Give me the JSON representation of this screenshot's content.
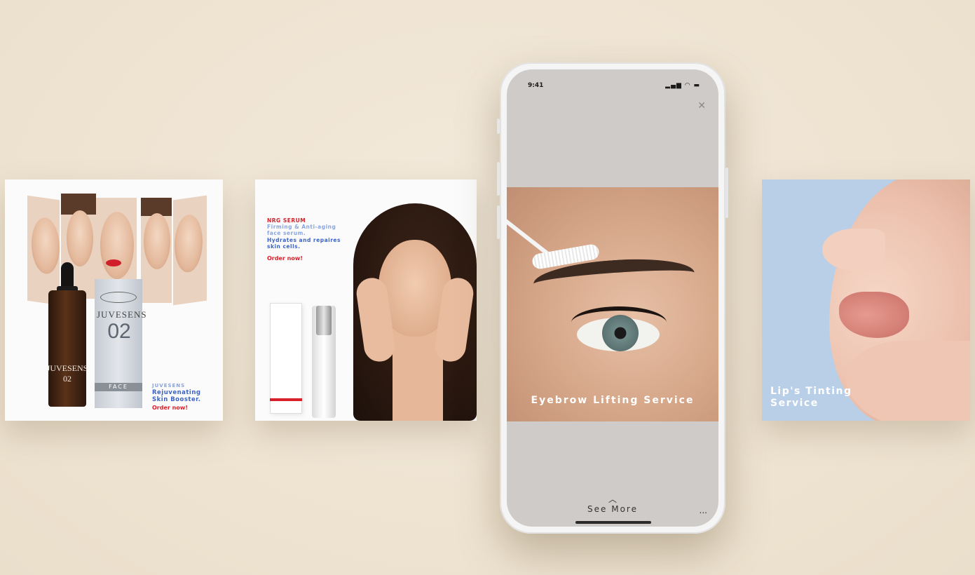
{
  "cards": {
    "juvesens": {
      "box_title": "JUVESENS",
      "box_number": "02",
      "box_band": "FACE",
      "bottle_label": "JUVESENS 02",
      "brand": "JUVESENS",
      "tagline": [
        "Rejuvenating",
        "Skin Booster."
      ],
      "cta": "Order now!"
    },
    "nrg_serum": {
      "title": "NRG SERUM",
      "desc_light": [
        "Firming & Anti-aging",
        "face serum."
      ],
      "desc_dark": [
        "Hydrates and repaires",
        "skin cells."
      ],
      "cta": "Order now!"
    },
    "lips": {
      "caption": [
        "Lip's Tinting",
        "Service"
      ]
    }
  },
  "phone": {
    "time": "9:41",
    "status_icons": "▂▄▆ ◠ ▬",
    "close_icon": "close-icon",
    "hero_caption": "Eyebrow Lifting Service",
    "see_more_chevron": "︿",
    "see_more": "See More",
    "more_dots": "..."
  }
}
